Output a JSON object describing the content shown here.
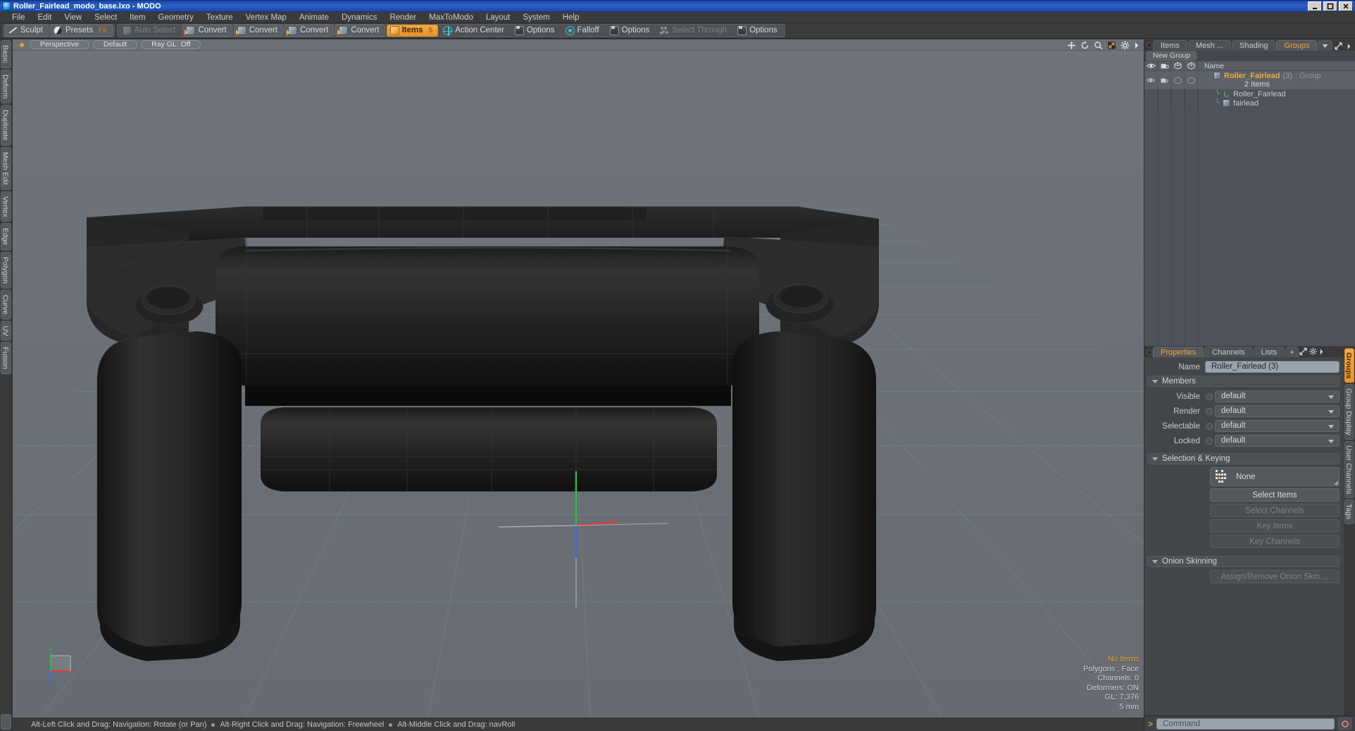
{
  "window": {
    "title": "Roller_Fairlead_modo_base.lxo - MODO",
    "app_icon": "modo-app-icon",
    "buttons": {
      "minimize": "_",
      "maximize": "❐",
      "close": "✕"
    }
  },
  "menubar": {
    "items": [
      "File",
      "Edit",
      "View",
      "Select",
      "Item",
      "Geometry",
      "Texture",
      "Vertex Map",
      "Animate",
      "Dynamics",
      "Render",
      "MaxToModo",
      "Layout",
      "System",
      "Help"
    ]
  },
  "toolbar": {
    "group1": [
      {
        "label": "Sculpt",
        "icon": "sculpt-icon",
        "state": "normal",
        "shortcut": ""
      },
      {
        "label": "Presets",
        "icon": "sphere-icon",
        "state": "normal",
        "shortcut": "F6"
      }
    ],
    "group2": [
      {
        "label": "Auto Select",
        "icon": "cube-icon",
        "state": "disabled",
        "shortcut": ""
      },
      {
        "label": "Convert",
        "icon": "cube-arrow-icon",
        "state": "normal",
        "shortcut": ""
      },
      {
        "label": "Convert",
        "icon": "cube-arrow-icon",
        "state": "normal",
        "shortcut": ""
      },
      {
        "label": "Convert",
        "icon": "cube-arrow-icon",
        "state": "normal",
        "shortcut": ""
      },
      {
        "label": "Convert",
        "icon": "cube-arrow-icon",
        "state": "normal",
        "shortcut": ""
      },
      {
        "label": "Items",
        "icon": "cube-orange-icon",
        "state": "active",
        "shortcut": "5"
      },
      {
        "label": "Action Center",
        "icon": "crosshair-icon",
        "state": "normal",
        "shortcut": ""
      },
      {
        "label": "Options",
        "icon": "options-icon",
        "state": "normal",
        "shortcut": ""
      },
      {
        "label": "Falloff",
        "icon": "falloff-icon",
        "state": "normal",
        "shortcut": ""
      },
      {
        "label": "Options",
        "icon": "options-icon",
        "state": "normal",
        "shortcut": ""
      },
      {
        "label": "Select Through",
        "icon": "select-through-icon",
        "state": "disabled",
        "shortcut": ""
      },
      {
        "label": "Options",
        "icon": "options-icon",
        "state": "normal",
        "shortcut": ""
      }
    ]
  },
  "left_tabs": {
    "items": [
      "Basic",
      "Deform",
      "Duplicate",
      "Mesh Edit",
      "Vertex",
      "Edge",
      "Polygon",
      "Curve",
      "UV",
      "Fusion"
    ]
  },
  "viewport": {
    "header": {
      "view_mode": "Perspective",
      "shading": "Default",
      "raygl": "Ray GL: Off",
      "icons": [
        "move-icon",
        "rotate-icon",
        "zoom-icon",
        "fit-icon",
        "gear-icon",
        "chevron-right-icon"
      ]
    },
    "stats": {
      "selection": "No Items",
      "polygons": "Polygons : Face",
      "channels": "Channels: 0",
      "deformers": "Deformers: ON",
      "gl": "GL: 7,376",
      "grid": "5 mm"
    },
    "axis_labels": {
      "x": "X",
      "y": "Y",
      "z": "Z"
    }
  },
  "statusbar": {
    "hints": [
      "Alt-Left Click and Drag: Navigation: Rotate (or Pan)",
      "Alt-Right Click and Drag: Navigation: Freewheel",
      "Alt-Middle Click and Drag: navRoll"
    ]
  },
  "right_panel": {
    "tabs": [
      {
        "label": "Items",
        "selected": false
      },
      {
        "label": "Mesh ...",
        "selected": false
      },
      {
        "label": "Shading",
        "selected": false
      },
      {
        "label": "Groups",
        "selected": true
      }
    ],
    "tab_overflow_icon": "chevron-down-icon",
    "expand_icon": "expand-icon",
    "more_icon": "chevron-right-icon",
    "new_group_button": "New Group",
    "list": {
      "columns": [
        "visible-eye-icon",
        "render-icon",
        "select-icon",
        "lock-icon",
        "Name"
      ],
      "name_header": "Name",
      "rows": [
        {
          "type": "group",
          "name": "Roller_Fairlead",
          "count": "(3)",
          "kind": ": Group",
          "sub": "2 Items",
          "icon": "group-cube-icon",
          "selected": true
        },
        {
          "type": "item",
          "name": "Roller_Fairlead",
          "icon": "locator-icon"
        },
        {
          "type": "item",
          "name": "fairlead",
          "icon": "mesh-cube-icon"
        }
      ]
    }
  },
  "properties": {
    "tabs": [
      {
        "label": "Properties",
        "selected": true
      },
      {
        "label": "Channels",
        "selected": false
      },
      {
        "label": "Lists",
        "selected": false
      },
      {
        "label": "+",
        "selected": false
      }
    ],
    "expand_icon": "expand-icon",
    "gear_icon": "gear-icon",
    "more_icon": "chevron-right-icon",
    "name_label": "Name",
    "name_value": "Roller_Fairlead (3)",
    "sections": [
      {
        "title": "Members",
        "fields": [
          {
            "label": "Visible",
            "value": "default"
          },
          {
            "label": "Render",
            "value": "default"
          },
          {
            "label": "Selectable",
            "value": "default"
          },
          {
            "label": "Locked",
            "value": "default"
          }
        ]
      },
      {
        "title": "Selection & Keying",
        "selection_mode": "None",
        "buttons": [
          {
            "label": "Select Items",
            "disabled": false
          },
          {
            "label": "Select Channels",
            "disabled": true
          },
          {
            "label": "Key Items",
            "disabled": true
          },
          {
            "label": "Key Channels",
            "disabled": true
          }
        ]
      },
      {
        "title": "Onion Skinning",
        "buttons": [
          {
            "label": "Assign/Remove Onion Skin ...",
            "disabled": true
          }
        ]
      }
    ],
    "right_tabs": [
      {
        "label": "Groups",
        "selected": true
      },
      {
        "label": "Group Display",
        "selected": false
      },
      {
        "label": "User Channels",
        "selected": false
      },
      {
        "label": "Tags",
        "selected": false
      }
    ]
  },
  "command_line": {
    "prompt": ">",
    "placeholder": "Command",
    "record_icon": "record-icon"
  },
  "colors": {
    "accent_orange": "#f0a838",
    "panel_bg": "#3a3a3a",
    "viewport_bg": "#6a7076",
    "field_bg": "#9aa4ad",
    "titlebar_blue": "#1c49a8"
  }
}
